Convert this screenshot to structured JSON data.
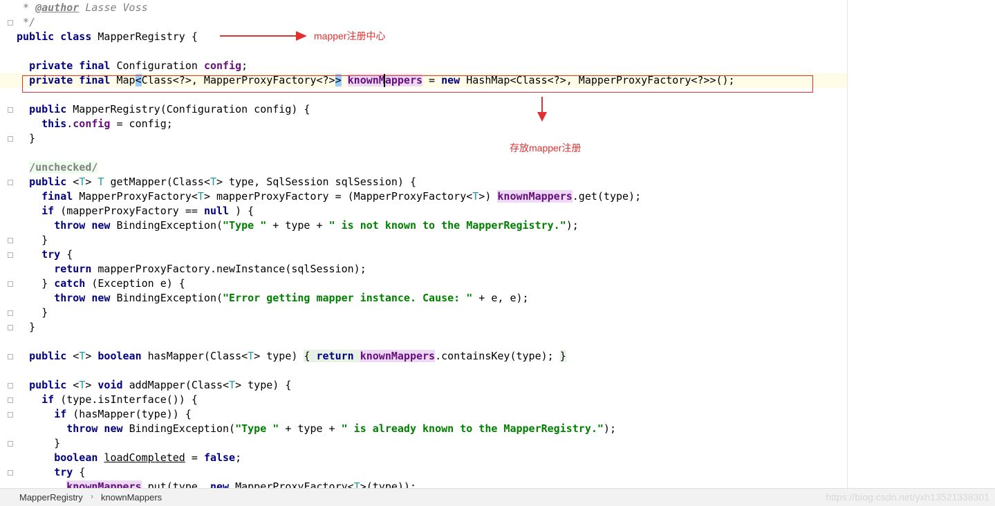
{
  "editor": {
    "lines": [
      {
        "t": 0,
        "parts": [
          [
            "cmt",
            " * "
          ],
          [
            "tag",
            "@author"
          ],
          [
            "cmt",
            " Lasse Voss"
          ]
        ]
      },
      {
        "t": 1,
        "parts": [
          [
            "cmt",
            " */"
          ]
        ]
      },
      {
        "t": 2,
        "parts": [
          [
            "kw",
            "public class "
          ],
          [
            "",
            "MapperRegistry {"
          ]
        ]
      },
      {
        "t": 4,
        "parts": [
          [
            "",
            "  "
          ],
          [
            "kw",
            "private final "
          ],
          [
            "",
            "Configuration "
          ],
          [
            "field",
            "config"
          ],
          [
            "",
            ";"
          ]
        ]
      },
      {
        "t": 5,
        "parts": [
          [
            "",
            "  "
          ],
          [
            "kw",
            "private final "
          ],
          [
            "",
            "Map"
          ],
          [
            "brace-hl",
            "<"
          ],
          [
            "",
            "Class<?>, MapperProxyFactory<?>"
          ],
          [
            "brace-hl",
            ">"
          ],
          [
            "",
            " "
          ],
          [
            "field-hl",
            "knownMappers"
          ],
          [
            "",
            " = "
          ],
          [
            "kw",
            "new "
          ],
          [
            "",
            "HashMap<Class<?>, MapperProxyFactory<?>>();"
          ]
        ]
      },
      {
        "t": 7,
        "parts": [
          [
            "",
            "  "
          ],
          [
            "kw",
            "public "
          ],
          [
            "",
            "MapperRegistry(Configuration config) {"
          ]
        ]
      },
      {
        "t": 8,
        "parts": [
          [
            "",
            "    "
          ],
          [
            "kw",
            "this"
          ],
          [
            "",
            "."
          ],
          [
            "field",
            "config"
          ],
          [
            "",
            " = config;"
          ]
        ]
      },
      {
        "t": 9,
        "parts": [
          [
            "",
            "  }"
          ]
        ]
      },
      {
        "t": 11,
        "parts": [
          [
            "",
            "  "
          ],
          [
            "suppress",
            "/unchecked/"
          ]
        ]
      },
      {
        "t": 12,
        "parts": [
          [
            "",
            "  "
          ],
          [
            "kw",
            "public "
          ],
          [
            "",
            "<"
          ],
          [
            "tp",
            "T"
          ],
          [
            "",
            "> "
          ],
          [
            "tp",
            "T"
          ],
          [
            "",
            " getMapper(Class<"
          ],
          [
            "tp",
            "T"
          ],
          [
            "",
            "> type, SqlSession sqlSession) {"
          ]
        ]
      },
      {
        "t": 13,
        "parts": [
          [
            "",
            "    "
          ],
          [
            "kw",
            "final "
          ],
          [
            "",
            "MapperProxyFactory<"
          ],
          [
            "tp",
            "T"
          ],
          [
            "",
            "> mapperProxyFactory = (MapperProxyFactory<"
          ],
          [
            "tp",
            "T"
          ],
          [
            "",
            ">) "
          ],
          [
            "field-hl",
            "knownMappers"
          ],
          [
            "",
            ".get(type);"
          ]
        ]
      },
      {
        "t": 14,
        "parts": [
          [
            "",
            "    "
          ],
          [
            "kw",
            "if "
          ],
          [
            "",
            "(mapperProxyFactory == "
          ],
          [
            "kw",
            "null"
          ],
          [
            "",
            " ) {"
          ]
        ]
      },
      {
        "t": 15,
        "parts": [
          [
            "",
            "      "
          ],
          [
            "kw",
            "throw new "
          ],
          [
            "",
            "BindingException("
          ],
          [
            "str",
            "\"Type \""
          ],
          [
            "",
            " + type + "
          ],
          [
            "str",
            "\" is not known to the MapperRegistry.\""
          ],
          [
            "",
            ");"
          ]
        ]
      },
      {
        "t": 16,
        "parts": [
          [
            "",
            "    }"
          ]
        ]
      },
      {
        "t": 17,
        "parts": [
          [
            "",
            "    "
          ],
          [
            "kw",
            "try "
          ],
          [
            "",
            "{"
          ]
        ]
      },
      {
        "t": 18,
        "parts": [
          [
            "",
            "      "
          ],
          [
            "kw",
            "return "
          ],
          [
            "",
            "mapperProxyFactory.newInstance(sqlSession);"
          ]
        ]
      },
      {
        "t": 19,
        "parts": [
          [
            "",
            "    } "
          ],
          [
            "kw",
            "catch "
          ],
          [
            "",
            "(Exception e) {"
          ]
        ]
      },
      {
        "t": 20,
        "parts": [
          [
            "",
            "      "
          ],
          [
            "kw",
            "throw new "
          ],
          [
            "",
            "BindingException("
          ],
          [
            "str",
            "\"Error getting mapper instance. Cause: \""
          ],
          [
            "",
            " + e, e);"
          ]
        ]
      },
      {
        "t": 21,
        "parts": [
          [
            "",
            "    }"
          ]
        ]
      },
      {
        "t": 22,
        "parts": [
          [
            "",
            "  }"
          ]
        ]
      },
      {
        "t": 24,
        "parts": [
          [
            "",
            "  "
          ],
          [
            "kw",
            "public "
          ],
          [
            "",
            "<"
          ],
          [
            "tp",
            "T"
          ],
          [
            "",
            "> "
          ],
          [
            "kw",
            "boolean "
          ],
          [
            "",
            "hasMapper(Class<"
          ],
          [
            "tp",
            "T"
          ],
          [
            "",
            "> type) "
          ],
          [
            "folded",
            "{ "
          ],
          [
            "kw folded",
            "return "
          ],
          [
            "field-hl",
            "knownMappers"
          ],
          [
            "",
            ".containsKey(type); "
          ],
          [
            "folded",
            "}"
          ]
        ]
      },
      {
        "t": 26,
        "parts": [
          [
            "",
            "  "
          ],
          [
            "kw",
            "public "
          ],
          [
            "",
            "<"
          ],
          [
            "tp",
            "T"
          ],
          [
            "",
            "> "
          ],
          [
            "kw",
            "void "
          ],
          [
            "",
            "addMapper(Class<"
          ],
          [
            "tp",
            "T"
          ],
          [
            "",
            "> type) {"
          ]
        ]
      },
      {
        "t": 27,
        "parts": [
          [
            "",
            "    "
          ],
          [
            "kw",
            "if "
          ],
          [
            "",
            "(type.isInterface()) {"
          ]
        ]
      },
      {
        "t": 28,
        "parts": [
          [
            "",
            "      "
          ],
          [
            "kw",
            "if "
          ],
          [
            "",
            "(hasMapper(type)) {"
          ]
        ]
      },
      {
        "t": 29,
        "parts": [
          [
            "",
            "        "
          ],
          [
            "kw",
            "throw new "
          ],
          [
            "",
            "BindingException("
          ],
          [
            "str",
            "\"Type \""
          ],
          [
            "",
            " + type + "
          ],
          [
            "str",
            "\" is already known to the MapperRegistry.\""
          ],
          [
            "",
            ");"
          ]
        ]
      },
      {
        "t": 30,
        "parts": [
          [
            "",
            "      }"
          ]
        ]
      },
      {
        "t": 31,
        "parts": [
          [
            "",
            "      "
          ],
          [
            "kw",
            "boolean "
          ],
          [
            "underline",
            "loadCompleted"
          ],
          [
            "",
            " = "
          ],
          [
            "kw",
            "false"
          ],
          [
            "",
            ";"
          ]
        ]
      },
      {
        "t": 32,
        "parts": [
          [
            "",
            "      "
          ],
          [
            "kw",
            "try "
          ],
          [
            "",
            "{"
          ]
        ]
      },
      {
        "t": 33,
        "parts": [
          [
            "",
            "        "
          ],
          [
            "field-hl",
            "knownMappers"
          ],
          [
            "",
            ".put(type, "
          ],
          [
            "kw",
            "new "
          ],
          [
            "",
            "MapperProxyFactory<"
          ],
          [
            "tp",
            "T"
          ],
          [
            "",
            ">(type));"
          ]
        ]
      }
    ]
  },
  "annotations": {
    "class_note": "mapper注册中心",
    "field_note": "存放mapper注册"
  },
  "status_bar": {
    "crumbs": [
      "MapperRegistry",
      "knownMappers"
    ]
  },
  "watermark": "https://blog.csdn.net/yxh13521338301",
  "colors": {
    "annotation": "#e03030",
    "keyword": "#000080",
    "field": "#660e7a",
    "string": "#008000"
  }
}
